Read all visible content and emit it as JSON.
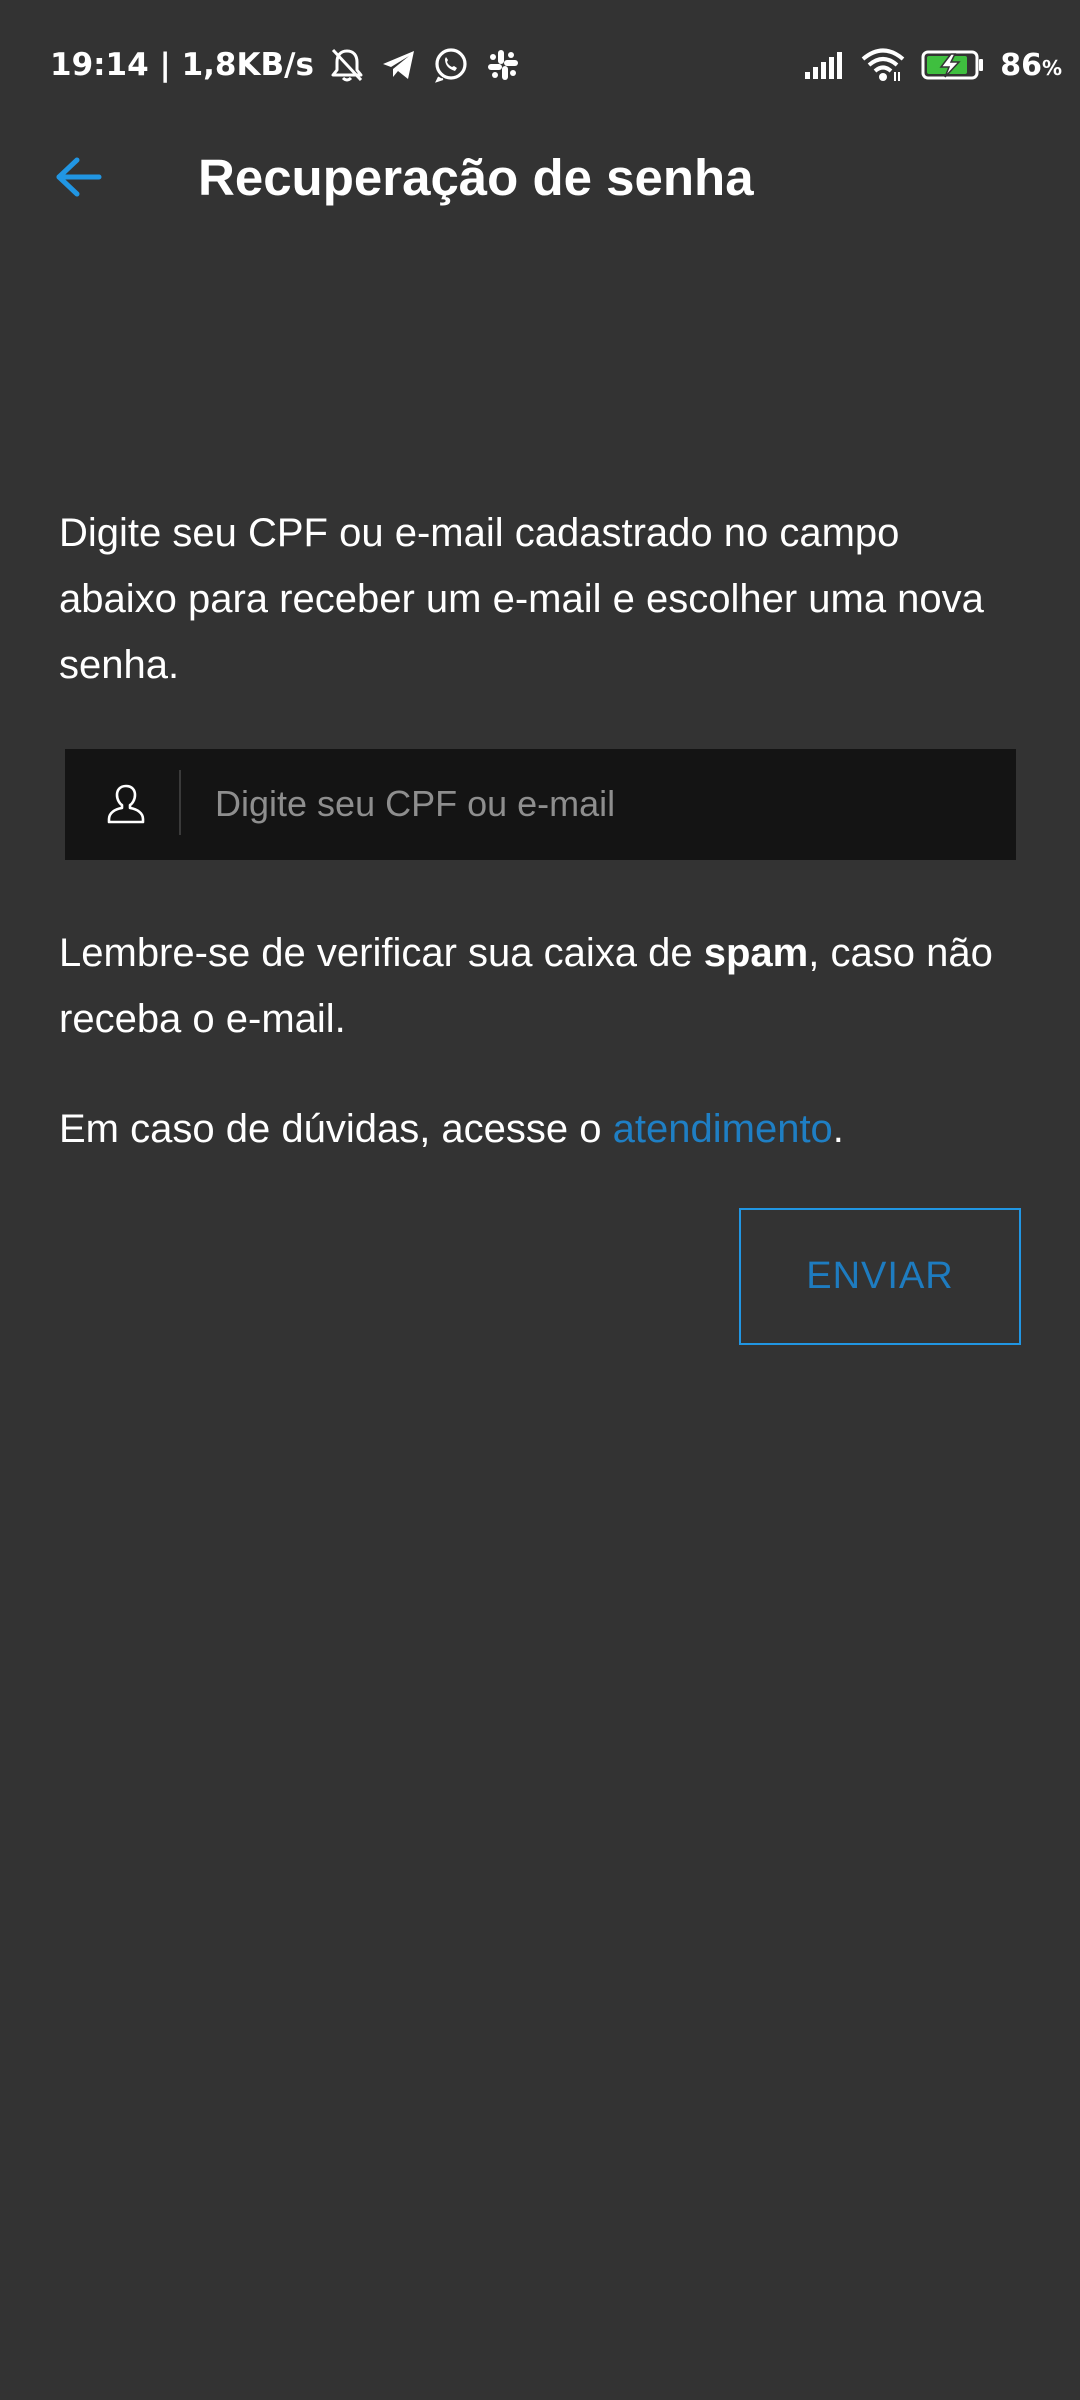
{
  "status_bar": {
    "time_speed": "19:14 | 1,8KB/s",
    "battery_value": "86",
    "battery_unit": "%",
    "icons": [
      "bell-off-icon",
      "telegram-icon",
      "whatsapp-icon",
      "slack-icon",
      "signal-icon",
      "wifi-icon",
      "battery-charging-icon"
    ]
  },
  "app_bar": {
    "title": "Recuperação de senha",
    "back_icon": "arrow-left-icon",
    "accent_color": "#2196e3"
  },
  "main": {
    "intro": "Digite seu CPF ou e-mail cadastrado no campo abaixo para receber um e-mail e escolher uma nova senha.",
    "input": {
      "placeholder": "Digite seu CPF ou e-mail",
      "value": "",
      "icon": "user-icon"
    },
    "spam_note": {
      "prefix": "Lembre-se de verificar sua caixa de ",
      "bold": "spam",
      "suffix": ", caso não receba o e-mail."
    },
    "help_note": {
      "prefix": "Em caso de dúvidas, acesse o ",
      "link": "atendimento",
      "suffix": "."
    },
    "send_button": "ENVIAR"
  }
}
